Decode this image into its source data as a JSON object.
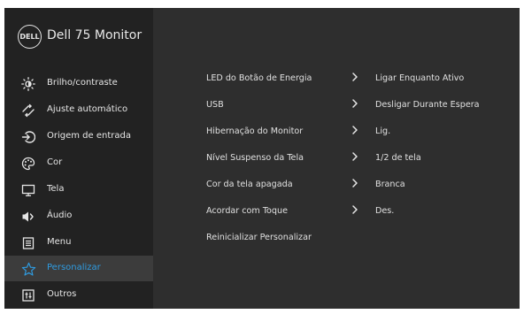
{
  "brand": {
    "logo_text": "DELL",
    "title": "Dell 75 Monitor"
  },
  "sidebar": {
    "items": [
      {
        "label": "Brilho/contraste",
        "icon": "brightness-icon"
      },
      {
        "label": "Ajuste automático",
        "icon": "auto-adjust-icon"
      },
      {
        "label": "Origem de entrada",
        "icon": "input-source-icon"
      },
      {
        "label": "Cor",
        "icon": "palette-icon"
      },
      {
        "label": "Tela",
        "icon": "display-icon"
      },
      {
        "label": "Áudio",
        "icon": "speaker-icon"
      },
      {
        "label": "Menu",
        "icon": "menu-list-icon"
      },
      {
        "label": "Personalizar",
        "icon": "star-icon",
        "active": true
      },
      {
        "label": "Outros",
        "icon": "others-icon"
      }
    ]
  },
  "settings": [
    {
      "label": "LED do Botão de Energia",
      "value": "Ligar Enquanto Ativo"
    },
    {
      "label": "USB",
      "value": "Desligar Durante Espera"
    },
    {
      "label": "Hibernação do Monitor",
      "value": "Lig."
    },
    {
      "label": "Nível Suspenso da Tela",
      "value": "1/2 de tela"
    },
    {
      "label": "Cor da tela apagada",
      "value": "Branca"
    },
    {
      "label": "Acordar com Toque",
      "value": "Des."
    },
    {
      "label": "Reinicializar Personalizar"
    }
  ],
  "colors": {
    "sidebar_bg": "#222222",
    "content_bg": "#2e2e2e",
    "active_bg": "#3c3c3c",
    "accent": "#2f9be0",
    "text": "#e6e6e6"
  }
}
